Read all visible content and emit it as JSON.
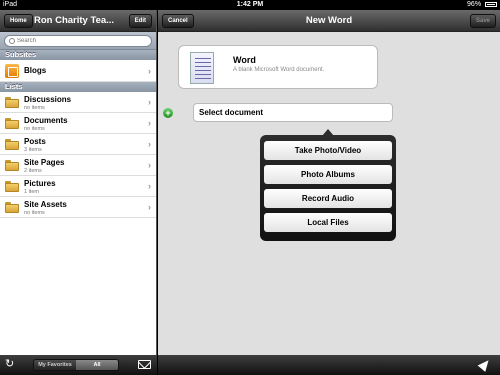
{
  "status_bar": {
    "device": "iPad",
    "time": "1:42 PM",
    "battery": "96%"
  },
  "left": {
    "home_label": "Home",
    "title": "Ron Charity Tea...",
    "edit_label": "Edit",
    "search_placeholder": "Search",
    "subsites_header": "Subsites",
    "subsites": [
      {
        "label": "Blogs"
      }
    ],
    "lists_header": "Lists",
    "lists": [
      {
        "label": "Discussions",
        "sub": "no items"
      },
      {
        "label": "Documents",
        "sub": "no items"
      },
      {
        "label": "Posts",
        "sub": "3 items"
      },
      {
        "label": "Site Pages",
        "sub": "2 items"
      },
      {
        "label": "Pictures",
        "sub": "1 item"
      },
      {
        "label": "Site Assets",
        "sub": "no items"
      }
    ],
    "toolbar": {
      "favorites_label": "My Favorites",
      "all_label": "All"
    }
  },
  "right": {
    "cancel_label": "Cancel",
    "title": "New Word",
    "save_label": "Save",
    "card_title": "Word",
    "card_subtitle": "A blank Microsoft Word document.",
    "select_document": "Select document",
    "popover": [
      "Take Photo/Video",
      "Photo Albums",
      "Record Audio",
      "Local Files"
    ]
  },
  "icons": [
    "wifi-icon",
    "battery-icon",
    "search-icon",
    "blog-icon",
    "folder-icon",
    "chevron-right-icon",
    "refresh-icon",
    "mail-icon",
    "word-document-icon",
    "add-icon",
    "location-arrow-icon"
  ]
}
